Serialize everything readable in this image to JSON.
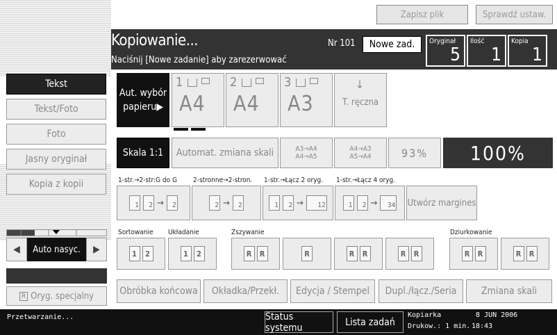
{
  "top_bar": {
    "save_file": "Zapisz plik",
    "check_settings": "Sprawdź ustaw."
  },
  "header": {
    "title": "Kopiowanie...",
    "subtitle": "Naciśnij [Nowe zadanie] aby zarezerwować",
    "job_number": "Nr 101",
    "new_job": "Nowe zad.",
    "counters": [
      {
        "label": "Oryginał",
        "value": "5"
      },
      {
        "label": "Ilość",
        "value": "1"
      },
      {
        "label": "Kopia",
        "value": "1"
      }
    ]
  },
  "original_types": [
    {
      "label": "Tekst",
      "selected": true
    },
    {
      "label": "Tekst/Foto",
      "selected": false
    },
    {
      "label": "Foto",
      "selected": false
    },
    {
      "label": "Jasny oryginał",
      "selected": false
    },
    {
      "label": "Kopia z kopii",
      "selected": false
    }
  ],
  "density": {
    "label": "Auto nasyc.",
    "left_icon": "triangle-left",
    "right_icon": "triangle-right"
  },
  "special_original": {
    "label": "Oryg. specjalny",
    "icon": "R-icons"
  },
  "paper": {
    "auto_line1": "Aut. wybór",
    "auto_line2": "papieru",
    "auto_arrow": "▶",
    "trays": [
      {
        "num": "1",
        "size": "A4"
      },
      {
        "num": "2",
        "size": "A4"
      },
      {
        "num": "3",
        "size": "A3"
      }
    ],
    "manual": "T. ręczna",
    "manual_icon": "↓"
  },
  "scale": {
    "full": "Skala 1:1",
    "auto_reduce": "Automat. zmiana skali",
    "preset1_top": "A3→A4",
    "preset1_bottom": "A4→A5",
    "preset2_top": "A4→A3",
    "preset2_bottom": "A5→A4",
    "preset_pct": "93%",
    "current": "100%"
  },
  "duplex": {
    "labels": [
      "1-str.→2-str:G do G",
      "2-stronne→2-stron.",
      "1-str.→Łącz 2 oryg.",
      "1-str.→Łącz 4 oryg."
    ],
    "margins": "Utwórz margines"
  },
  "finishing": {
    "sort": "Sortowanie",
    "stack": "Układanie",
    "staple": "Zszywanie",
    "punch": "Dziurkowanie"
  },
  "tabs": [
    "Obróbka końcowa",
    "Okładka/Przekł.",
    "Edycja / Stempel",
    "Dupl./łącz./Seria",
    "Zmiana skali"
  ],
  "status_bar": {
    "processing": "Przetwarzanie...",
    "system_status": "Status systemu",
    "job_list": "Lista zadań",
    "copier": "Kopiarka",
    "printer": "Drukow.: 1 min.",
    "date": "8 JUN  2006",
    "time": "18:43"
  }
}
